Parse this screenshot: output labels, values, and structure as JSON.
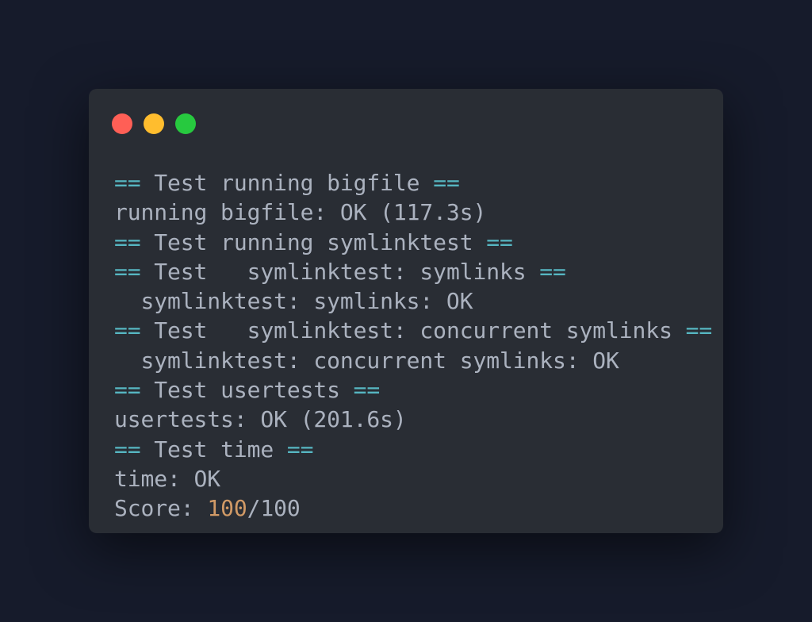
{
  "window": {
    "controls": [
      {
        "name": "close",
        "color": "#ff5f56"
      },
      {
        "name": "minimize",
        "color": "#ffbd2e"
      },
      {
        "name": "maximize",
        "color": "#27c93f"
      }
    ]
  },
  "theme": {
    "background": "#161b2b",
    "terminal_background": "#292d34",
    "text_color": "#abb2bf",
    "marker_color": "#56b6c2",
    "score_color": "#d19a66"
  },
  "output": {
    "marker": "==",
    "lines": [
      {
        "type": "test",
        "text": "Test running bigfile"
      },
      {
        "type": "plain",
        "text": "running bigfile: OK (117.3s)"
      },
      {
        "type": "test",
        "text": "Test running symlinktest"
      },
      {
        "type": "test",
        "text": "Test   symlinktest: symlinks"
      },
      {
        "type": "plain",
        "text": "  symlinktest: symlinks: OK"
      },
      {
        "type": "test",
        "text": "Test   symlinktest: concurrent symlinks"
      },
      {
        "type": "plain",
        "text": "  symlinktest: concurrent symlinks: OK"
      },
      {
        "type": "test",
        "text": "Test usertests"
      },
      {
        "type": "plain",
        "text": "usertests: OK (201.6s)"
      },
      {
        "type": "test",
        "text": "Test time"
      },
      {
        "type": "plain",
        "text": "time: OK"
      }
    ],
    "score": {
      "label": "Score: ",
      "value": "100",
      "total": "/100"
    }
  }
}
